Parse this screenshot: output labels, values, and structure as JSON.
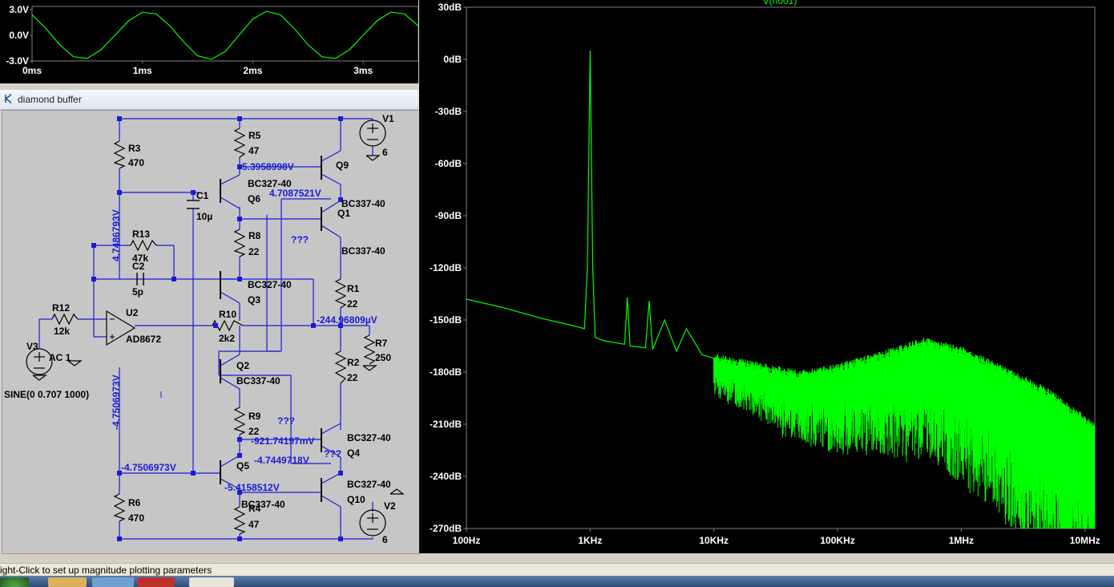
{
  "waveform": {
    "y_ticks": [
      "3.0V",
      "0.0V",
      "-3.0V"
    ],
    "x_ticks": [
      "0ms",
      "1ms",
      "2ms",
      "3ms"
    ]
  },
  "schematic": {
    "window_title": "diamond buffer",
    "components": {
      "R3": {
        "ref": "R3",
        "value": "470"
      },
      "R5": {
        "ref": "R5",
        "value": "47"
      },
      "R8": {
        "ref": "R8",
        "value": "22"
      },
      "R13": {
        "ref": "R13",
        "value": "47k"
      },
      "C1": {
        "ref": "C1",
        "value": "10µ"
      },
      "C2": {
        "ref": "C2",
        "value": "5p"
      },
      "R12": {
        "ref": "R12",
        "value": "12k"
      },
      "U2": {
        "ref": "U2",
        "value": "AD8672"
      },
      "V3": {
        "ref": "V3",
        "value": "AC 1",
        "source": "SINE(0 0.707 1000)"
      },
      "R10": {
        "ref": "R10",
        "value": "2k2"
      },
      "Q6": {
        "ref": "Q6",
        "value": "BC327-40"
      },
      "Q3": {
        "ref": "Q3",
        "value": "BC327-40"
      },
      "Q2": {
        "ref": "Q2",
        "value": "BC337-40"
      },
      "Q5": {
        "ref": "Q5",
        "value": "BC337-40"
      },
      "Q9": {
        "ref": "Q9"
      },
      "Q1": {
        "ref": "Q1",
        "value": "BC337-40"
      },
      "Q1b": {
        "value": "BC337-40"
      },
      "Q4": {
        "ref": "Q4",
        "value": "BC327-40"
      },
      "Q10": {
        "ref": "Q10",
        "value": "BC327-40"
      },
      "R1": {
        "ref": "R1",
        "value": "22"
      },
      "R2": {
        "ref": "R2",
        "value": "22"
      },
      "R7": {
        "ref": "R7",
        "value": "250"
      },
      "R9": {
        "ref": "R9",
        "value": "22"
      },
      "R6": {
        "ref": "R6",
        "value": "470"
      },
      "R4": {
        "ref": "R4",
        "value": "47"
      },
      "V1": {
        "ref": "V1",
        "value": "6"
      },
      "V2": {
        "ref": "V2",
        "value": "6"
      }
    },
    "node_labels": {
      "n1": "5.3958998V",
      "n2": "4.7087521V",
      "n3": "4.7486793V",
      "n4": "-244.96809µV",
      "n5": "-4.7506973V",
      "n6": "-4.7506973V",
      "n7": "-921.74197mV",
      "n8": "-4.7449718V",
      "n9": "-5.4158512V",
      "q1": "???",
      "q2": "???",
      "q3": "???"
    }
  },
  "spectrum": {
    "title": "V(n001)",
    "y_ticks": [
      "30dB",
      "0dB",
      "-30dB",
      "-60dB",
      "-90dB",
      "-120dB",
      "-150dB",
      "-180dB",
      "-210dB",
      "-240dB",
      "-270dB"
    ],
    "x_ticks": [
      "100Hz",
      "1KHz",
      "10KHz",
      "100KHz",
      "1MHz",
      "10MHz"
    ],
    "trace_color": "#00ff00"
  },
  "status": {
    "text": "ight-Click to set up magnitude plotting parameters"
  },
  "chart_data": [
    {
      "type": "line",
      "xlabel": "",
      "ylabel": "",
      "x_unit": "ms",
      "y_unit": "V",
      "xlim": [
        0,
        3.5
      ],
      "ylim": [
        -3,
        3
      ],
      "x_ticks": [
        "0ms",
        "1ms",
        "2ms",
        "3ms"
      ],
      "y_ticks": [
        "3.0V",
        "0.0V",
        "-3.0V"
      ],
      "series": [
        {
          "color": "#00ff00",
          "x": [
            0,
            0.125,
            0.25,
            0.375,
            0.5,
            0.625,
            0.75,
            0.875,
            1.0,
            1.125,
            1.25,
            1.375,
            1.5,
            1.625,
            1.75,
            1.875,
            2.0,
            2.125,
            2.25,
            2.375,
            2.5,
            2.625,
            2.75,
            2.875,
            3.0,
            3.125,
            3.25,
            3.375,
            3.5
          ],
          "y": [
            2.4,
            0.8,
            -1.1,
            -2.5,
            -2.7,
            -1.7,
            0.0,
            1.7,
            2.7,
            2.5,
            1.1,
            -0.8,
            -2.4,
            -2.8,
            -1.9,
            0.0,
            1.9,
            2.8,
            2.4,
            0.8,
            -1.1,
            -2.5,
            -2.7,
            -1.7,
            0.0,
            1.7,
            2.7,
            2.5,
            1.1
          ]
        }
      ],
      "grid": false
    },
    {
      "type": "line",
      "title": "V(n001)",
      "xlabel": "",
      "ylabel": "",
      "x_scale": "log",
      "xlim": [
        100,
        12000000
      ],
      "ylim": [
        -270,
        30
      ],
      "x_ticks": [
        "100Hz",
        "1KHz",
        "10KHz",
        "100KHz",
        "1MHz",
        "10MHz"
      ],
      "y_ticks": [
        "30dB",
        "0dB",
        "-30dB",
        "-60dB",
        "-90dB",
        "-120dB",
        "-150dB",
        "-180dB",
        "-210dB",
        "-240dB",
        "-270dB"
      ],
      "series": [
        {
          "color": "#00ff00",
          "x": [
            100,
            200,
            400,
            700,
            900,
            950,
            1000,
            1050,
            1100,
            1300,
            1900,
            2000,
            2100,
            2800,
            3000,
            3200,
            4000,
            5000,
            6000,
            8000,
            10000,
            20000,
            50000,
            100000,
            200000,
            500000,
            1000000,
            2000000,
            5000000,
            12000000
          ],
          "y": [
            -138,
            -143,
            -149,
            -153,
            -155,
            -120,
            5,
            -120,
            -160,
            -162,
            -164,
            -137,
            -165,
            -166,
            -139,
            -167,
            -150,
            -168,
            -155,
            -170,
            -172,
            -176,
            -182,
            -178,
            -172,
            -163,
            -168,
            -178,
            -192,
            -212
          ],
          "noise_floor_min_db": -270
        }
      ],
      "grid": false
    }
  ]
}
